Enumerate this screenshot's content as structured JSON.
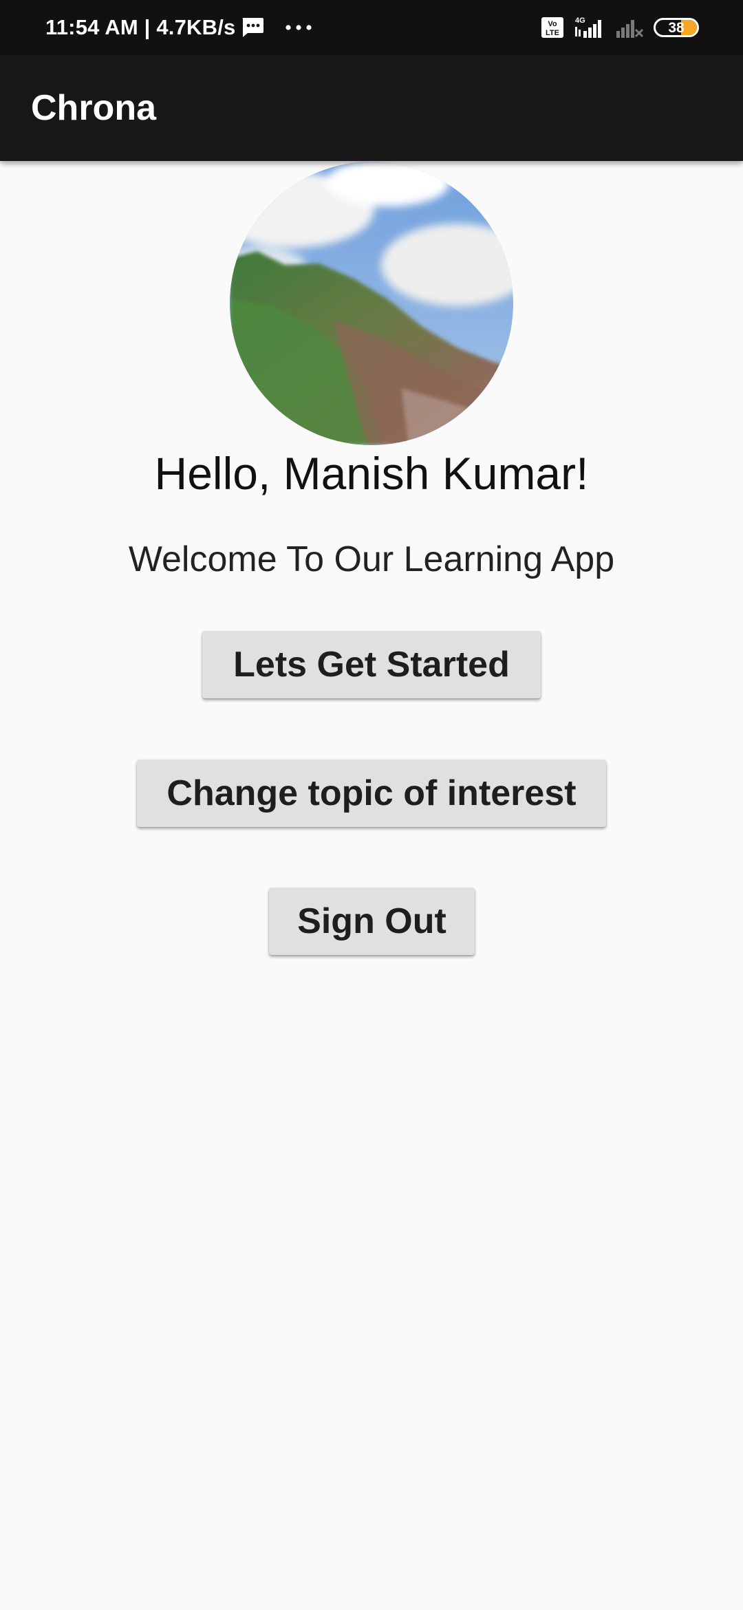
{
  "status_bar": {
    "time_speed": "11:54 AM | 4.7KB/s",
    "network_type": "4G",
    "volte_label": "Vo LTE",
    "battery_level": "38",
    "battery_fraction": 0.38,
    "icons": [
      "message-icon",
      "more-dots-icon",
      "volte-icon",
      "signal-icon",
      "signal-no-service-icon",
      "battery-icon"
    ],
    "battery_color": "#f5a623"
  },
  "app_bar": {
    "title": "Chrona",
    "background": "#171717"
  },
  "profile": {
    "avatar_icon": "profile-photo-mountain",
    "greeting": "Hello, Manish Kumar!",
    "welcome": "Welcome To Our Learning App"
  },
  "buttons": {
    "get_started": "Lets Get Started",
    "change_topic": "Change topic of interest",
    "sign_out": "Sign Out"
  }
}
